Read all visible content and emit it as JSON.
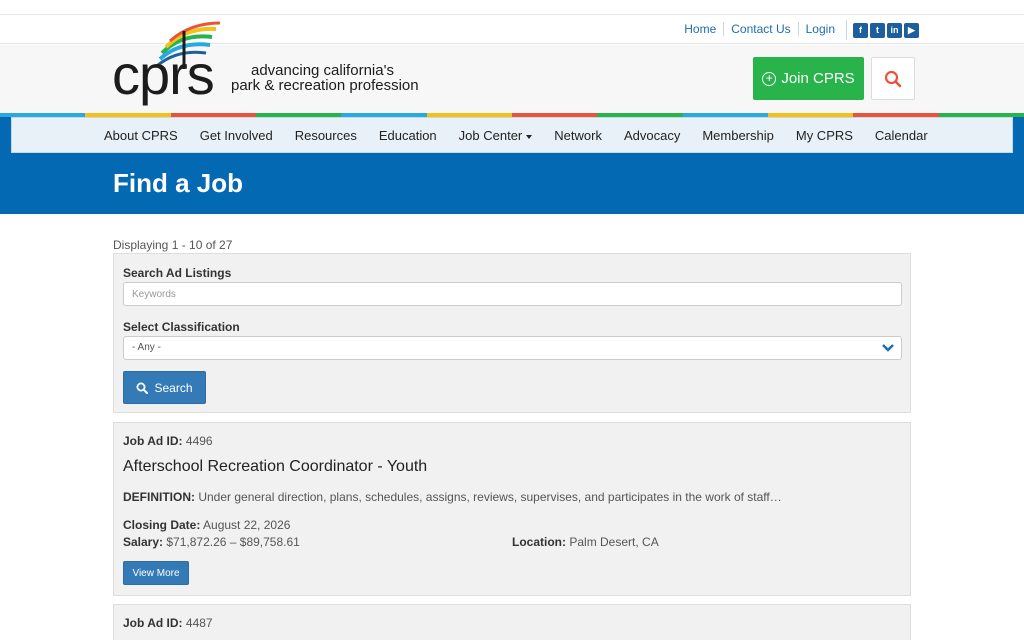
{
  "top_links": [
    "Home",
    "Contact Us",
    "Login"
  ],
  "social": [
    {
      "icon": "facebook-icon",
      "glyph": "f"
    },
    {
      "icon": "twitter-icon",
      "glyph": "t"
    },
    {
      "icon": "linkedin-icon",
      "glyph": "in"
    },
    {
      "icon": "youtube-icon",
      "glyph": "▶"
    }
  ],
  "logo": {
    "mark": "cprs",
    "tagline_1": "advancing california's",
    "tagline_2": "park & recreation profession"
  },
  "header": {
    "join_label": "Join CPRS",
    "search_icon": "search-icon"
  },
  "stripe_colors": [
    "#2aa9e0",
    "#f2c21b",
    "#e8533a",
    "#28b34b",
    "#2aa9e0",
    "#f2c21b",
    "#e8533a",
    "#28b34b",
    "#2aa9e0",
    "#f2c21b",
    "#e8533a",
    "#28b34b"
  ],
  "nav": [
    "About CPRS",
    "Get Involved",
    "Resources",
    "Education",
    "Job Center",
    "Network",
    "Advocacy",
    "Membership",
    "My CPRS",
    "Calendar"
  ],
  "page_title": "Find a Job",
  "displaying": "Displaying 1 - 10 of 27",
  "search": {
    "label": "Search Ad Listings",
    "placeholder": "Keywords",
    "classification_label": "Select Classification",
    "classification_value": "- Any -",
    "button_label": "Search"
  },
  "jobs": [
    {
      "id_label": "Job Ad ID:",
      "id": "4496",
      "title": "Afterschool Recreation Coordinator - Youth",
      "definition_label": "DEFINITION:",
      "definition": "Under general direction, plans, schedules, assigns, reviews, supervises, and participates in the work of staff…",
      "closing_label": "Closing Date:",
      "closing": "August 22, 2026",
      "salary_label": "Salary:",
      "salary": "$71,872.26 – $89,758.61",
      "location_label": "Location:",
      "location": "Palm Desert, CA",
      "view_label": "View More"
    },
    {
      "id_label": "Job Ad ID:",
      "id": "4487"
    }
  ],
  "colors": {
    "brand_blue": "#0369b2",
    "join_green": "#28b34b",
    "button_blue": "#337ab7",
    "link_blue": "#1d6fa9"
  }
}
